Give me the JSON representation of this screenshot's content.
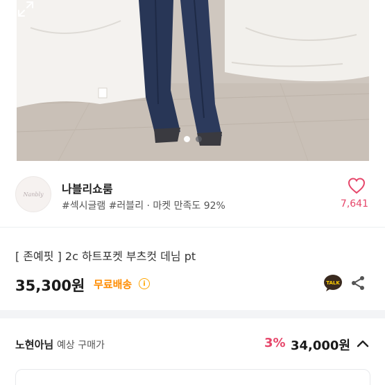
{
  "gallery": {
    "image_subject": "",
    "slide_count": 2,
    "active_slide": 1
  },
  "shop": {
    "logo_text": "Nanbly",
    "name": "나블리쇼룸",
    "tags": "#섹시글램 #러블리 · 마켓 만족도 92%",
    "likes": "7,641"
  },
  "product": {
    "title": "[ 존예핏 ] 2c 하트포켓 부츠컷 데님 pt",
    "price": "35,300원",
    "shipping": "무료배송",
    "shipping_info_glyph": "i",
    "talk_badge": "TALK"
  },
  "estimate": {
    "name": "노현아님",
    "description": "예상 구매가",
    "discount": "3%",
    "price": "34,000원"
  },
  "colors": {
    "accent_pink": "#e6466a",
    "shipping_orange": "#ff8c00"
  }
}
